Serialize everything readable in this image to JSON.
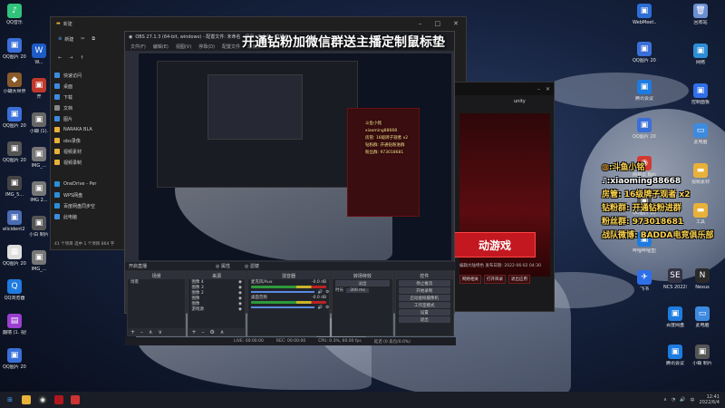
{
  "headline": "开通钻粉加微信群送主播定制鼠标垫",
  "desktop_left": [
    {
      "label": "QQ音乐",
      "color": "#31c27c",
      "glyph": "♪"
    },
    {
      "label": "QQ图片 20220505...",
      "color": "#3a6fd8",
      "glyph": "▣"
    },
    {
      "label": "小蝴大世界",
      "color": "#8a5a2a",
      "glyph": "◆"
    },
    {
      "label": "QQ图片 20220519...",
      "color": "#3a6fd8",
      "glyph": "▣"
    },
    {
      "label": "QQ图片 20220519...",
      "color": "#555",
      "glyph": "▣"
    },
    {
      "label": "IMG_5...",
      "color": "#444",
      "glyph": "▣"
    },
    {
      "label": "elicident2 20220...",
      "color": "#4a6cb4",
      "glyph": "▣"
    },
    {
      "label": "QQ图片 20220525...",
      "color": "#ddd",
      "glyph": "▦"
    },
    {
      "label": "QQ浏览器",
      "color": "#1e7be0",
      "glyph": "Q"
    },
    {
      "label": "翻墙 (1. 视频 海沃...",
      "color": "#9a3fd0",
      "glyph": "▤"
    },
    {
      "label": "QQ图片 20220...",
      "color": "#3a6fd8",
      "glyph": "▣"
    }
  ],
  "desktop_left2": [
    {
      "label": "W...",
      "color": "#1d5cc7",
      "glyph": "W"
    },
    {
      "label": "开",
      "color": "#c0392b",
      "glyph": "▣"
    },
    {
      "label": "小蝴 (1).",
      "color": "#666",
      "glyph": "▣"
    },
    {
      "label": "IMG_...",
      "color": "#777",
      "glyph": "▣"
    },
    {
      "label": "IMG 2...",
      "color": "#777",
      "glyph": "▣"
    },
    {
      "label": "小白 制片",
      "color": "#555",
      "glyph": "▣"
    },
    {
      "label": "IMG_...",
      "color": "#777",
      "glyph": "▣"
    }
  ],
  "desktop_right": [
    {
      "label": "WebMeet...",
      "color": "#2c6ed6",
      "glyph": "▣"
    },
    {
      "label": "QQ图片 20220...",
      "color": "#3a6fd8",
      "glyph": "▣"
    },
    {
      "label": "腾讯会议",
      "color": "#1e7be0",
      "glyph": "▣"
    },
    {
      "label": "QQ图片 20211204...",
      "color": "#3a6fd8",
      "glyph": "▣"
    },
    {
      "label": "网易云 Beta",
      "color": "#d33a31",
      "glyph": "◉"
    },
    {
      "label": "QQ图片 20220223...",
      "color": "#555",
      "glyph": "▣"
    },
    {
      "label": "哔哩哔哩直播",
      "color": "#1e7be0",
      "glyph": "▣"
    },
    {
      "label": "飞书",
      "color": "#2f6fe8",
      "glyph": "✈"
    }
  ],
  "desktop_right2": [
    {
      "label": "回收站",
      "color": "#6a8fd0",
      "glyph": "🗑"
    },
    {
      "label": "网络",
      "color": "#2c8ed6",
      "glyph": "▣"
    },
    {
      "label": "控制面板",
      "color": "#2f6fe8",
      "glyph": "▣"
    },
    {
      "label": "此电脑",
      "color": "#3d8be0",
      "glyph": "▭"
    },
    {
      "label": "视频素材",
      "color": "#e8b13a",
      "glyph": "▬"
    },
    {
      "label": "工具",
      "color": "#e8b13a",
      "glyph": "▬"
    }
  ],
  "desktop_bottom_right": [
    {
      "label": "NCS 2022年...",
      "color": "#334",
      "glyph": "SE"
    },
    {
      "label": "Nexus",
      "color": "#2a2a2a",
      "glyph": "N"
    },
    {
      "label": "百度网盘",
      "color": "#1e7be0",
      "glyph": "▣"
    },
    {
      "label": "此电脑",
      "color": "#3d8be0",
      "glyph": "▭"
    },
    {
      "label": "腾讯会议",
      "color": "#1e7be0",
      "glyph": "▣"
    },
    {
      "label": "小蝴 制片",
      "color": "#555",
      "glyph": "▣"
    }
  ],
  "explorer": {
    "title": "新建",
    "toolbar_new": "新建",
    "sidebar": [
      {
        "label": "快速访问",
        "color": "#3d8be0"
      },
      {
        "label": "桌面",
        "color": "#3d8be0"
      },
      {
        "label": "下载",
        "color": "#3d8be0"
      },
      {
        "label": "文档",
        "color": "#888"
      },
      {
        "label": "图片",
        "color": "#3d8be0"
      },
      {
        "label": "NARAKA  BLA",
        "color": "#e8b13a"
      },
      {
        "label": "obs录像",
        "color": "#e8b13a"
      },
      {
        "label": "视频素材",
        "color": "#e8b13a"
      },
      {
        "label": "视频录制",
        "color": "#e8b13a"
      },
      {
        "label": "",
        "color": "transparent"
      },
      {
        "label": "OneDrive - Per",
        "color": "#2c8ed6"
      },
      {
        "label": "WPS网盘",
        "color": "#2c8ed6"
      },
      {
        "label": "百度网盘同步空",
        "color": "#2c8ed6"
      },
      {
        "label": "此电脑",
        "color": "#3d8be0"
      }
    ],
    "status": "41 个项目   选中 1 个项目  864 字"
  },
  "obs": {
    "title": "OBS 27.1.3 (64-bit, windows) - 配置文件: 未命名 - 场景: 未命名 - 直播画...",
    "menu": [
      "文件(F)",
      "编辑(E)",
      "视图(V)",
      "停靠(D)",
      "配置文件",
      "场景集",
      "工具"
    ],
    "scenebar_left": "开启直播",
    "scenebar_mid": "◎ 属性",
    "scenebar_right": "◎ 滤镜",
    "docks": {
      "scenes": {
        "title": "场景",
        "items": [
          "场景"
        ]
      },
      "sources": {
        "title": "来源",
        "items": [
          "图像 4",
          "图像 3",
          "图像 2",
          "图像",
          "图像",
          "游戏源"
        ]
      },
      "mixer": {
        "title": "混音器",
        "ch1": "麦克风/Aux",
        "ch1_db": "-0.0 dB",
        "ch2": "桌面音频",
        "ch2_db": "-0.0 dB"
      },
      "transitions": {
        "title": "转场特效",
        "type": "淡出",
        "duration_label": "时长",
        "duration": "300 ms"
      },
      "controls": {
        "title": "控件",
        "buttons": [
          "停止推流",
          "开始录制",
          "启动虚拟摄像机",
          "工作室模式",
          "设置",
          "退出"
        ]
      }
    },
    "status": [
      "LIVE: 00:00:00",
      "REC: 00:00:00",
      "CPU: 0.3%, 60.00 fps",
      "延迟 (0 丢包/0.0%)"
    ]
  },
  "game": {
    "unity": "unity",
    "start_label": "动游戏",
    "meta": "编辑大陆特色   发布日期: 2022-06-02 04:30",
    "links": [
      "网络相关",
      "打开目录",
      "退出应用"
    ]
  },
  "overlay": {
    "douyu": "斗鱼小铭",
    "douyin": "xiaoming88668",
    "fangguan": "房管: 16级牌子观者 x2",
    "zuanfen": "钻粉群: 开通钻粉进群",
    "fensi": "粉丝群: 973018681",
    "weibo": "战队微博: BADDA电竞俱乐部"
  },
  "taskbar": {
    "time": "12:41",
    "date": "2022/6/4",
    "tray_text": "中"
  }
}
